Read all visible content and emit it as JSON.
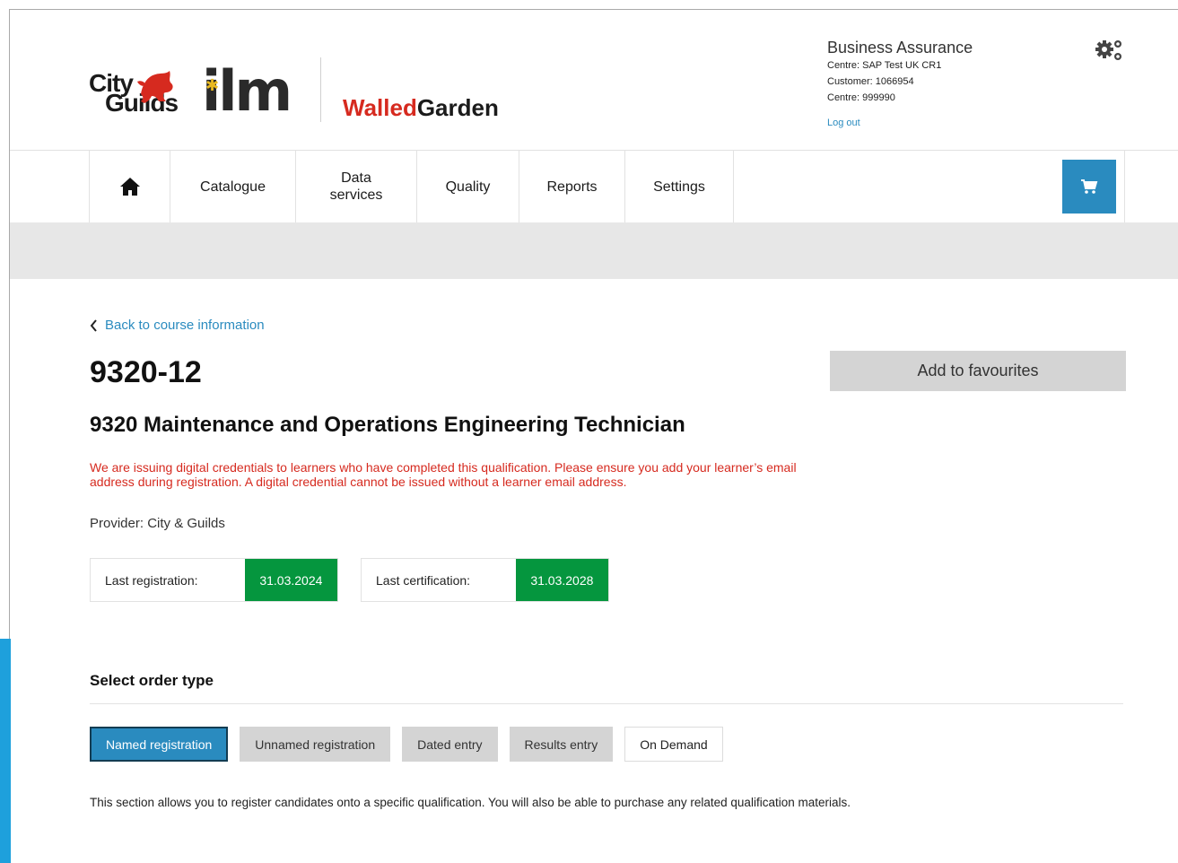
{
  "header": {
    "logo_city": "City",
    "logo_guilds": "Guilds",
    "logo_ilm": "ilm",
    "brand_walled": "Walled",
    "brand_garden": "Garden",
    "account_title": "Business Assurance",
    "centre_name": "Centre: SAP Test UK CR1",
    "customer": "Customer: 1066954",
    "centre_code": "Centre: 999990",
    "logout": "Log out"
  },
  "nav": {
    "home_icon": "home-icon",
    "catalogue": "Catalogue",
    "data_services_1": "Data",
    "data_services_2": "services",
    "quality": "Quality",
    "reports": "Reports",
    "settings": "Settings",
    "cart_icon": "cart-icon"
  },
  "page": {
    "back_link": "Back to course information",
    "code": "9320-12",
    "favourites": "Add to favourites",
    "title": "9320 Maintenance and Operations Engineering Technician",
    "notice": "We are issuing digital credentials to learners who have completed this qualification. Please ensure you add your learner’s email address during registration. A digital credential cannot be issued without a learner email address.",
    "provider": "Provider: City & Guilds",
    "last_registration_label": "Last registration:",
    "last_registration_value": "31.03.2024",
    "last_certification_label": "Last certification:",
    "last_certification_value": "31.03.2028"
  },
  "order": {
    "heading": "Select order type",
    "types": [
      "Named registration",
      "Unnamed registration",
      "Dated entry",
      "Results entry",
      "On Demand"
    ],
    "description": "This section allows you to register candidates onto a specific qualification. You will also be able to purchase any related qualification materials."
  },
  "colors": {
    "accent": "#2a8bbf",
    "brand_red": "#d62a1f",
    "date_green": "#05963e"
  }
}
